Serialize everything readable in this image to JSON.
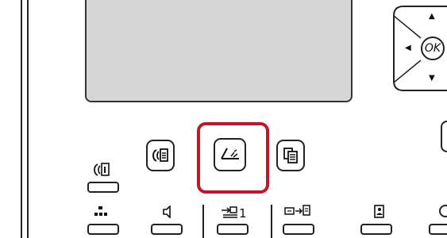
{
  "panel": {
    "ok_label": "OK",
    "counter_value": "1",
    "highlight_color": "#c4162b",
    "display_color": "#d6d6d6"
  },
  "icons": {
    "fax_status": "fax-document-icon",
    "fax_mode": "fax-document-icon",
    "scan_mode": "scanner-icon",
    "copy_mode": "copy-icon",
    "network": "network-icon",
    "speaker": "speaker-icon",
    "input_tray": "input-tray-icon",
    "duplex": "duplex-scan-icon",
    "address_book": "address-book-icon"
  }
}
